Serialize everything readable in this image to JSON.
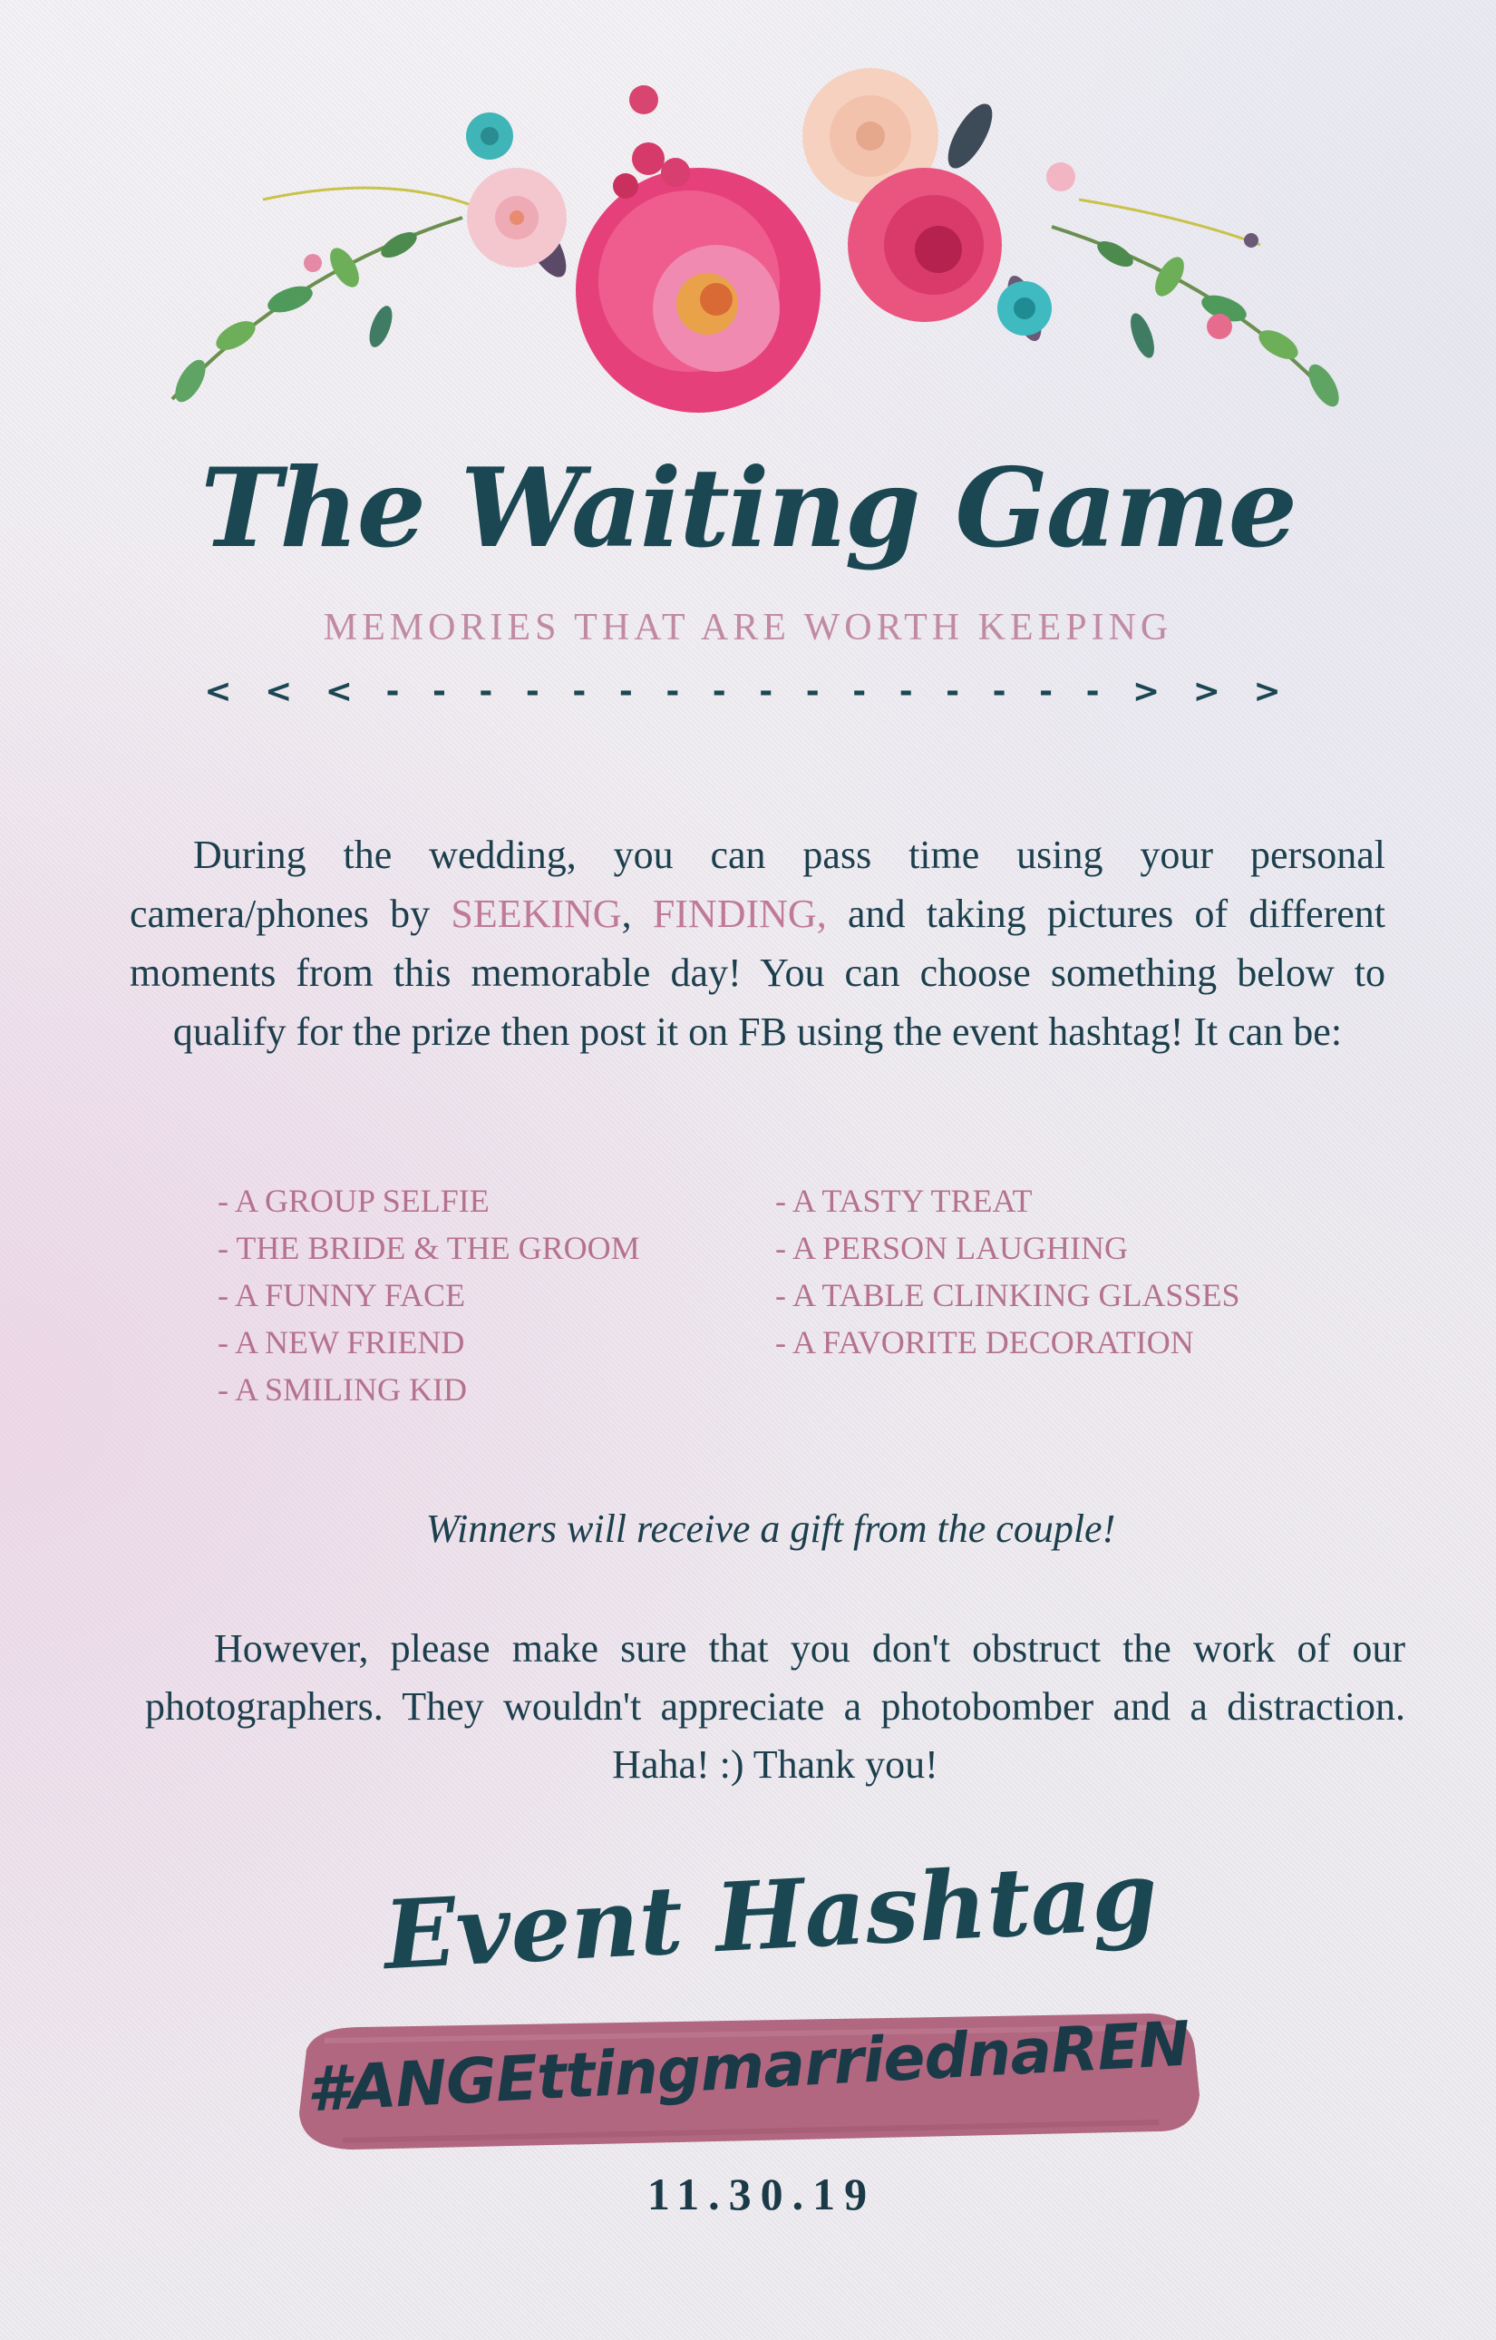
{
  "title": "The Waiting Game",
  "subtitle": "MEMORIES THAT ARE WORTH KEEPING",
  "divider": "< < < - - - - - - - - - - - - - - - - > > >",
  "intro": {
    "part1": "During the wedding, you can pass time using your personal camera/phones by ",
    "seeking": "SEEKING",
    "comma": ", ",
    "finding": "FINDING,",
    "part2": " and taking pictures of different moments from this memorable day! You can choose something below to qualify for the prize then post it on FB using the event hashtag! It can be:"
  },
  "list_left": [
    "A GROUP SELFIE",
    "THE BRIDE & THE GROOM",
    "A FUNNY FACE",
    "A NEW FRIEND",
    "A SMILING KID"
  ],
  "list_right": [
    "A TASTY TREAT",
    "A PERSON LAUGHING",
    "A TABLE CLINKING GLASSES",
    "A FAVORITE DECORATION"
  ],
  "winners": "Winners will receive a gift from the couple!",
  "however": "However, please make sure that you don't obstruct the work of our photographers. They wouldn't appreciate a photobomber and a distraction. Haha! :) Thank you!",
  "hashtag_heading": "Event Hashtag",
  "hashtag": "#ANGEttingmarriednaREN",
  "date": "11.30.19",
  "colors": {
    "teal": "#1a4752",
    "mauve": "#c18aa3",
    "brush": "#b0677f"
  },
  "icons": [
    "floral-arrangement-icon",
    "brush-stroke-icon"
  ]
}
